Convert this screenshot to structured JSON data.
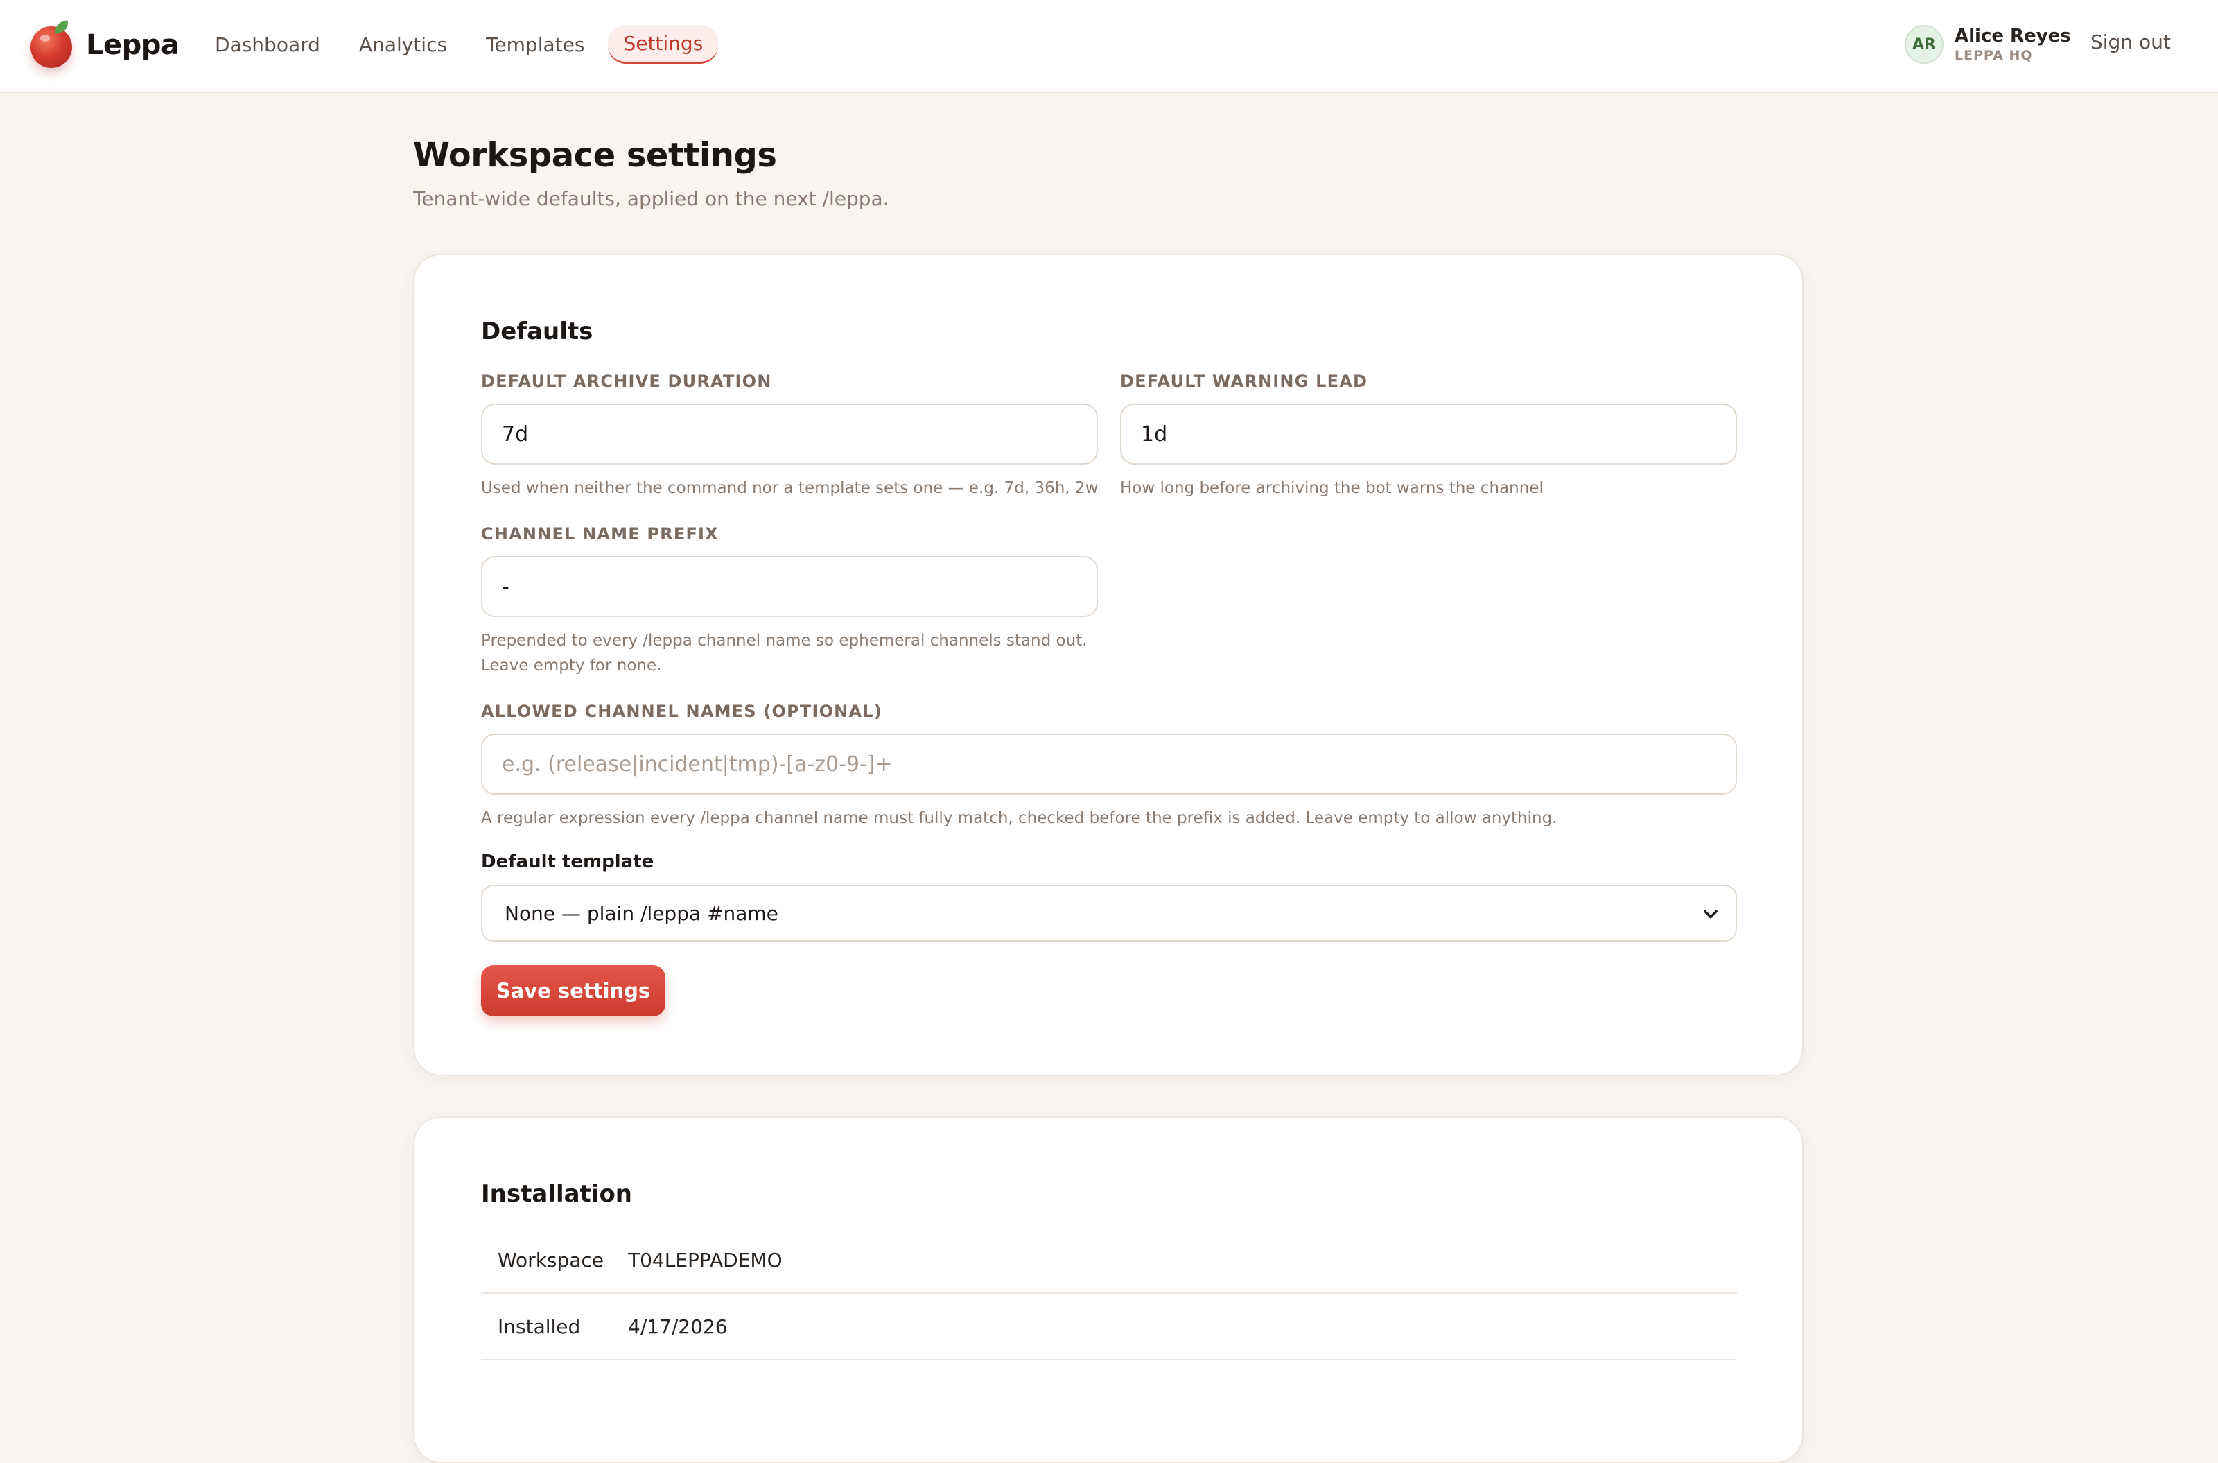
{
  "app": {
    "name": "Leppa"
  },
  "nav": {
    "items": [
      {
        "label": "Dashboard"
      },
      {
        "label": "Analytics"
      },
      {
        "label": "Templates"
      },
      {
        "label": "Settings",
        "active": true
      }
    ]
  },
  "user": {
    "initials": "AR",
    "name": "Alice Reyes",
    "org": "LEPPA HQ",
    "signout_label": "Sign out"
  },
  "page": {
    "title": "Workspace settings",
    "subtitle": "Tenant-wide defaults, applied on the next /leppa."
  },
  "defaults": {
    "title": "Defaults",
    "archive_duration": {
      "label": "DEFAULT ARCHIVE DURATION",
      "value": "7d",
      "hint": "Used when neither the command nor a template sets one — e.g. 7d, 36h, 2w"
    },
    "warning_lead": {
      "label": "DEFAULT WARNING LEAD",
      "value": "1d",
      "hint": "How long before archiving the bot warns the channel"
    },
    "channel_prefix": {
      "label": "CHANNEL NAME PREFIX",
      "value": "-",
      "hint_line1": "Prepended to every /leppa channel name so ephemeral channels stand out.",
      "hint_line2": "Leave empty for none."
    },
    "allowed_names": {
      "label": "ALLOWED CHANNEL NAMES (OPTIONAL)",
      "placeholder": "e.g. (release|incident|tmp)-[a-z0-9-]+",
      "hint": "A regular expression every /leppa channel name must fully match, checked before the prefix is added. Leave empty to allow anything."
    },
    "default_template": {
      "label": "Default template",
      "selected": "None — plain /leppa #name"
    },
    "save_label": "Save settings"
  },
  "installation": {
    "title": "Installation",
    "rows": [
      {
        "key": "Workspace",
        "value": "T04LEPPADEMO"
      },
      {
        "key": "Installed",
        "value": "4/17/2026"
      }
    ]
  },
  "colors": {
    "accent": "#d6473a",
    "background": "#f8f4f0",
    "card": "#ffffff"
  }
}
